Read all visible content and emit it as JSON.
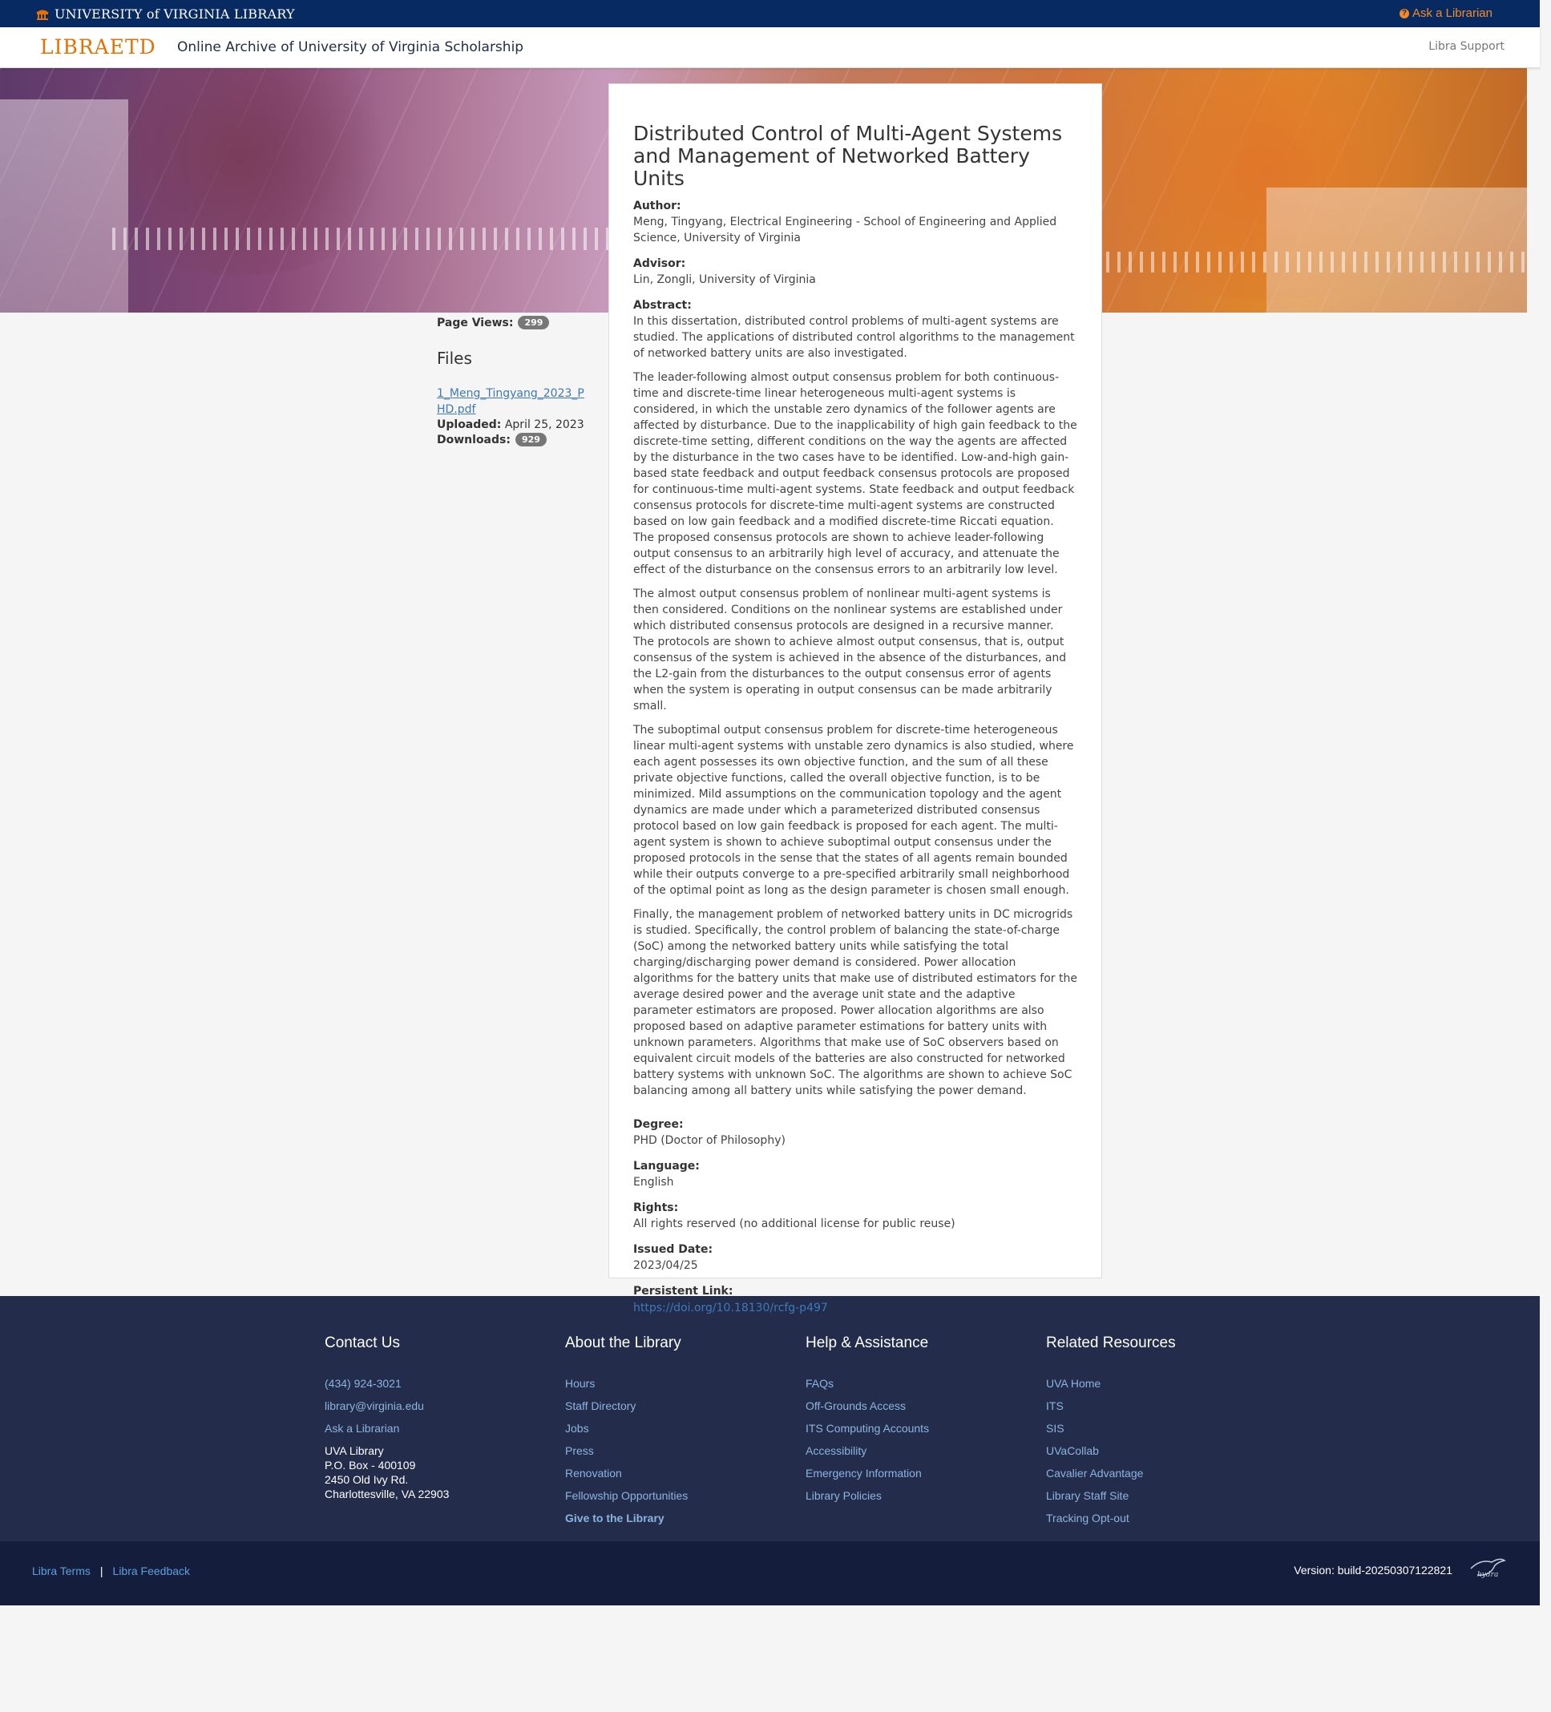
{
  "topbar": {
    "library_logo": "UNIVERSITY of VIRGINIA LIBRARY",
    "ask_librarian": "Ask a Librarian"
  },
  "navbar": {
    "brand": "LIBRAETD",
    "subtitle": "Online Archive of University of Virginia Scholarship",
    "support": "Libra Support"
  },
  "sidebar": {
    "page_views_label": "Page Views:",
    "page_views": "299",
    "files_heading": "Files",
    "file_name": "1_Meng_Tingyang_2023_PHD.pdf",
    "uploaded_label": "Uploaded:",
    "uploaded_date": "April 25, 2023",
    "downloads_label": "Downloads:",
    "downloads": "929"
  },
  "work": {
    "title": "Distributed Control of Multi-Agent Systems and Management of Networked Battery Units",
    "author_label": "Author:",
    "author": "Meng, Tingyang, Electrical Engineering - School of Engineering and Applied Science, University of Virginia",
    "advisor_label": "Advisor:",
    "advisor": "Lin, Zongli, University of Virginia",
    "abstract_label": "Abstract:",
    "abstract": [
      "In this dissertation, distributed control problems of multi-agent systems are studied. The applications of distributed control algorithms to the management of networked battery units are also investigated.",
      "The leader-following almost output consensus problem for both continuous-time and discrete-time linear heterogeneous multi-agent systems is considered, in which the unstable zero dynamics of the follower agents are affected by disturbance. Due to the inapplicability of high gain feedback to the discrete-time setting, different conditions on the way the agents are affected by the disturbance in the two cases have to be identified. Low-and-high gain-based state feedback and output feedback consensus protocols are proposed for continuous-time multi-agent systems. State feedback and output feedback consensus protocols for discrete-time multi-agent systems are constructed based on low gain feedback and a modified discrete-time Riccati equation. The proposed consensus protocols are shown to achieve leader-following output consensus to an arbitrarily high level of accuracy, and attenuate the effect of the disturbance on the consensus errors to an arbitrarily low level.",
      "The almost output consensus problem of nonlinear multi-agent systems is then considered. Conditions on the nonlinear systems are established under which distributed consensus protocols are designed in a recursive manner. The protocols are shown to achieve almost output consensus, that is, output consensus of the system is achieved in the absence of the disturbances, and the L2-gain from the disturbances to the output consensus error of agents when the system is operating in output consensus can be made arbitrarily small.",
      "The suboptimal output consensus problem for discrete-time heterogeneous linear multi-agent systems with unstable zero dynamics is also studied, where each agent possesses its own objective function, and the sum of all these private objective functions, called the overall objective function, is to be minimized. Mild assumptions on the communication topology and the agent dynamics are made under which a parameterized distributed consensus protocol based on low gain feedback is proposed for each agent. The multi-agent system is shown to achieve suboptimal output consensus under the proposed protocols in the sense that the states of all agents remain bounded while their outputs converge to a pre-specified arbitrarily small neighborhood of the optimal point as long as the design parameter is chosen small enough.",
      "Finally, the management problem of networked battery units in DC microgrids is studied. Specifically, the control problem of balancing the state-of-charge (SoC) among the networked battery units while satisfying the total charging/discharging power demand is considered. Power allocation algorithms for the battery units that make use of distributed estimators for the average desired power and the average unit state and the adaptive parameter estimators are proposed. Power allocation algorithms are also proposed based on adaptive parameter estimations for battery units with unknown parameters. Algorithms that make use of SoC observers based on equivalent circuit models of the batteries are also constructed for networked battery systems with unknown SoC. The algorithms are shown to achieve SoC balancing among all battery units while satisfying the power demand."
    ],
    "degree_label": "Degree:",
    "degree": "PHD (Doctor of Philosophy)",
    "language_label": "Language:",
    "language": "English",
    "rights_label": "Rights:",
    "rights": "All rights reserved (no additional license for public reuse)",
    "issued_label": "Issued Date:",
    "issued": "2023/04/25",
    "link_label": "Persistent Link:",
    "link": "https://doi.org/10.18130/rcfg-p497"
  },
  "footer": {
    "contact": {
      "heading": "Contact Us",
      "phone": "(434) 924-3021",
      "email": "library@virginia.edu",
      "ask": "Ask a Librarian",
      "address": [
        "UVA Library",
        "P.O. Box - 400109",
        "2450 Old Ivy Rd.",
        "Charlottesville, VA 22903"
      ]
    },
    "about": {
      "heading": "About the Library",
      "links": [
        "Hours",
        "Staff Directory",
        "Jobs",
        "Press",
        "Renovation",
        "Fellowship Opportunities"
      ],
      "give": "Give to the Library"
    },
    "help": {
      "heading": "Help & Assistance",
      "links": [
        "FAQs",
        "Off-Grounds Access",
        "ITS Computing Accounts",
        "Accessibility",
        "Emergency Information",
        "Library Policies"
      ]
    },
    "related": {
      "heading": "Related Resources",
      "links": [
        "UVA Home",
        "ITS",
        "SIS",
        "UVaCollab",
        "Cavalier Advantage",
        "Library Staff Site",
        "Tracking Opt-out"
      ]
    }
  },
  "subfooter": {
    "terms": "Libra Terms",
    "separator": "|",
    "feedback": "Libra Feedback",
    "version": "Version: build-20250307122821",
    "hydra_logo": "hydra"
  }
}
